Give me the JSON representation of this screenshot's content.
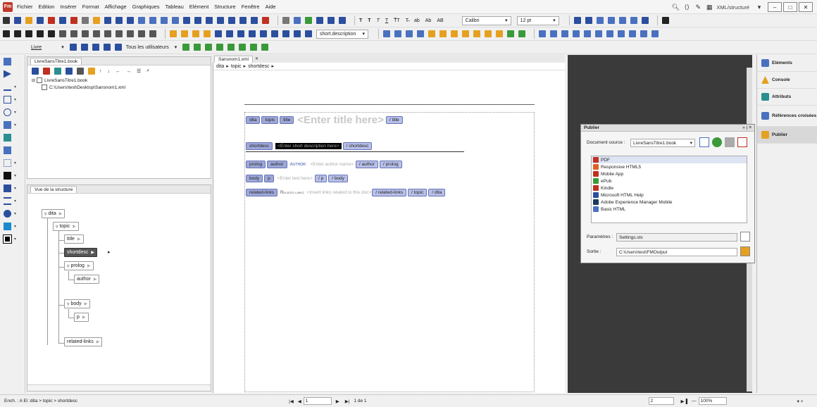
{
  "menu": [
    "Fichier",
    "Edition",
    "Insérer",
    "Format",
    "Affichage",
    "Graphiques",
    "Tableau",
    "Elément",
    "Structure",
    "Fenêtre",
    "Aide"
  ],
  "app_logo": "Fm",
  "view_mode": "XML/structuré",
  "toolbar1": {
    "font": "Calibri",
    "size": "12 pt"
  },
  "toolbar2": {
    "element": "short.description"
  },
  "toolbar3": {
    "book_label": "Livre",
    "users_label": "Tous les utilisateurs"
  },
  "book_panel": {
    "tab": "LivreSansTitre1.book",
    "root": "LivreSansTitre1.book",
    "file": "C:\\Users\\test\\Desktop\\Sansnom1.xml"
  },
  "structure_panel": {
    "tab": "Vue de la structure",
    "nodes": [
      "dita",
      "topic",
      "title",
      "shortdesc",
      "prolog",
      "author",
      "body",
      "p",
      "related-links"
    ]
  },
  "document": {
    "tab": "Sansnom1.xml",
    "breadcrumb": [
      "dita",
      "topic",
      "shortdesc"
    ],
    "title_placeholder": "<Enter title here>",
    "shortdesc_placeholder": "<Enter short description here>",
    "author_label": "Author:",
    "author_placeholder": "<Enter author name>",
    "text_placeholder": "<Enter text here>",
    "related_label": "Related links:",
    "related_placeholder": "<Insert links related to this doc>",
    "tags": {
      "dita": "dita",
      "topic": "topic",
      "title": "title",
      "end_title": "/ title",
      "shortdesc": "shortdesc",
      "end_shortdesc": "/ shortdesc",
      "prolog": "prolog",
      "author": "author",
      "end_author": "/ author",
      "end_prolog": "/ prolog",
      "body": "body",
      "p": "p",
      "end_p": "/ p",
      "end_body": "/ body",
      "related_links": "related-links",
      "end_related_links": "/ related-links",
      "end_topic": "/ topic",
      "end_dita": "/ dita"
    }
  },
  "publish": {
    "title": "Publier",
    "source_label": "Document source :",
    "source_value": "LivreSansTitre1.book",
    "formats": [
      "PDF",
      "Responsive HTML5",
      "Mobile App",
      "ePub",
      "Kindle",
      "Microsoft HTML Help",
      "Adobe Experience Manager Mobile",
      "Basic HTML"
    ],
    "params_label": "Paramètres :",
    "params_value": "Settings.sts",
    "output_label": "Sortie :",
    "output_value": "C:\\Users\\test\\FMOutput"
  },
  "right_panel": [
    "Eléments",
    "Console",
    "Attributs",
    "Références croisées",
    "Publier"
  ],
  "status": {
    "path": "Ench. : A  El :dita > topic > shortdesc",
    "page_input": "1",
    "page_total": "1 de 1",
    "zoom_page": "2",
    "zoom": "100%"
  }
}
